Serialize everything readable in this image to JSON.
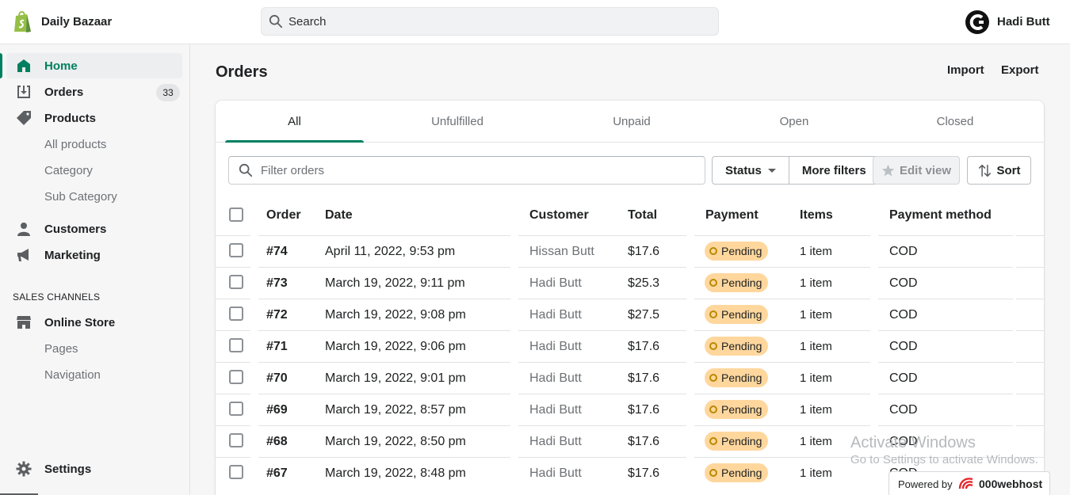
{
  "store": {
    "name": "Daily Bazaar"
  },
  "search": {
    "placeholder": "Search"
  },
  "user": {
    "name": "Hadi Butt"
  },
  "sidebar": {
    "items": [
      {
        "label": "Home",
        "icon": "home-icon",
        "active": true
      },
      {
        "label": "Orders",
        "icon": "orders-icon",
        "badge": "33"
      },
      {
        "label": "Products",
        "icon": "tag-icon"
      },
      {
        "label": "Customers",
        "icon": "person-icon"
      },
      {
        "label": "Marketing",
        "icon": "megaphone-icon"
      }
    ],
    "product_sub": [
      "All products",
      "Category",
      "Sub Category"
    ],
    "sales_channels_title": "SALES CHANNELS",
    "online_store": {
      "label": "Online Store",
      "icon": "store-icon"
    },
    "store_sub": [
      "Pages",
      "Navigation"
    ],
    "settings": {
      "label": "Settings",
      "icon": "gear-icon"
    }
  },
  "page": {
    "title": "Orders",
    "import_label": "Import",
    "export_label": "Export"
  },
  "tabs": [
    "All",
    "Unfulfilled",
    "Unpaid",
    "Open",
    "Closed"
  ],
  "filters": {
    "placeholder": "Filter orders",
    "status_label": "Status",
    "more_filters_label": "More filters",
    "edit_view_label": "Edit view",
    "sort_label": "Sort"
  },
  "table": {
    "columns": [
      "Order",
      "Date",
      "Customer",
      "Total",
      "Payment",
      "Items",
      "Payment method"
    ],
    "rows": [
      {
        "order": "#74",
        "date": "April 11, 2022, 9:53 pm",
        "customer": "Hissan Butt",
        "total": "$17.6",
        "payment": "Pending",
        "items": "1 item",
        "method": "COD"
      },
      {
        "order": "#73",
        "date": "March 19, 2022, 9:11 pm",
        "customer": "Hadi Butt",
        "total": "$25.3",
        "payment": "Pending",
        "items": "1 item",
        "method": "COD"
      },
      {
        "order": "#72",
        "date": "March 19, 2022, 9:08 pm",
        "customer": "Hadi Butt",
        "total": "$27.5",
        "payment": "Pending",
        "items": "1 item",
        "method": "COD"
      },
      {
        "order": "#71",
        "date": "March 19, 2022, 9:06 pm",
        "customer": "Hadi Butt",
        "total": "$17.6",
        "payment": "Pending",
        "items": "1 item",
        "method": "COD"
      },
      {
        "order": "#70",
        "date": "March 19, 2022, 9:01 pm",
        "customer": "Hadi Butt",
        "total": "$17.6",
        "payment": "Pending",
        "items": "1 item",
        "method": "COD"
      },
      {
        "order": "#69",
        "date": "March 19, 2022, 8:57 pm",
        "customer": "Hadi Butt",
        "total": "$17.6",
        "payment": "Pending",
        "items": "1 item",
        "method": "COD"
      },
      {
        "order": "#68",
        "date": "March 19, 2022, 8:50 pm",
        "customer": "Hadi Butt",
        "total": "$17.6",
        "payment": "Pending",
        "items": "1 item",
        "method": "COD"
      },
      {
        "order": "#67",
        "date": "March 19, 2022, 8:48 pm",
        "customer": "Hadi Butt",
        "total": "$17.6",
        "payment": "Pending",
        "items": "1 item",
        "method": "COD"
      }
    ]
  },
  "overlay": {
    "activate_title": "Activate Windows",
    "activate_sub": "Go to Settings to activate Windows.",
    "powered_by": "Powered by",
    "host_name": "000webhost"
  },
  "colors": {
    "accent": "#008060",
    "pending_badge": "#ffd79d",
    "brand_green": "#95bf47"
  }
}
